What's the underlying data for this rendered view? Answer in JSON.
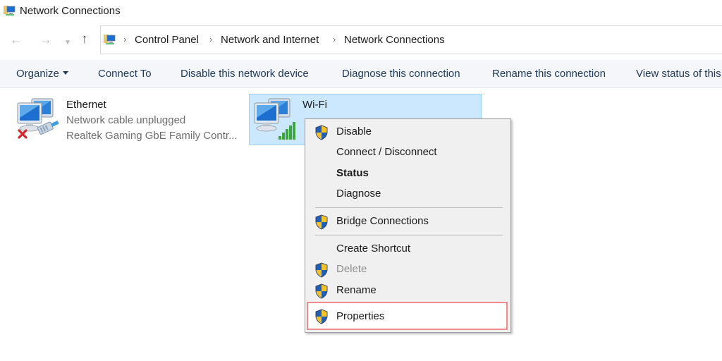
{
  "window": {
    "title": "Network Connections",
    "icon": "network-connections-icon"
  },
  "navigation": {
    "back_icon": "←",
    "forward_icon": "→",
    "recent_icon": "⌄",
    "up_icon": "↑",
    "breadcrumb": [
      "Control Panel",
      "Network and Internet",
      "Network Connections"
    ],
    "separator": "›"
  },
  "toolbar": {
    "items": [
      {
        "label": "Organize",
        "has_dropdown": true
      },
      {
        "label": "Connect To"
      },
      {
        "label": "Disable this network device"
      },
      {
        "label": "Diagnose this connection"
      },
      {
        "label": "Rename this connection"
      },
      {
        "label": "View status of this connection"
      }
    ]
  },
  "connections": [
    {
      "name": "Ethernet",
      "status": "Network cable unplugged",
      "device": "Realtek Gaming GbE Family Contr...",
      "icon": "ethernet-disconnected-icon",
      "selected": false
    },
    {
      "name": "Wi-Fi",
      "status": "",
      "device": "",
      "icon": "wifi-connection-icon",
      "selected": true
    }
  ],
  "context_menu": {
    "items": [
      {
        "label": "Disable",
        "shield": true
      },
      {
        "label": "Connect / Disconnect",
        "shield": false
      },
      {
        "label": "Status",
        "shield": false,
        "bold": true
      },
      {
        "label": "Diagnose",
        "shield": false
      },
      {
        "label": "Bridge Connections",
        "shield": true
      },
      {
        "label": "Create Shortcut",
        "shield": false
      },
      {
        "label": "Delete",
        "shield": true,
        "disabled": true
      },
      {
        "label": "Rename",
        "shield": true
      },
      {
        "label": "Properties",
        "shield": true,
        "highlighted": true
      }
    ]
  },
  "colors": {
    "selection_bg": "#cce8ff",
    "selection_border": "#99d1ff",
    "highlight_border": "#ef8a8d",
    "toolbar_text": "#1e395b",
    "toolbar_bg": "#f4f6f9",
    "menu_bg": "#f0f0f0"
  }
}
